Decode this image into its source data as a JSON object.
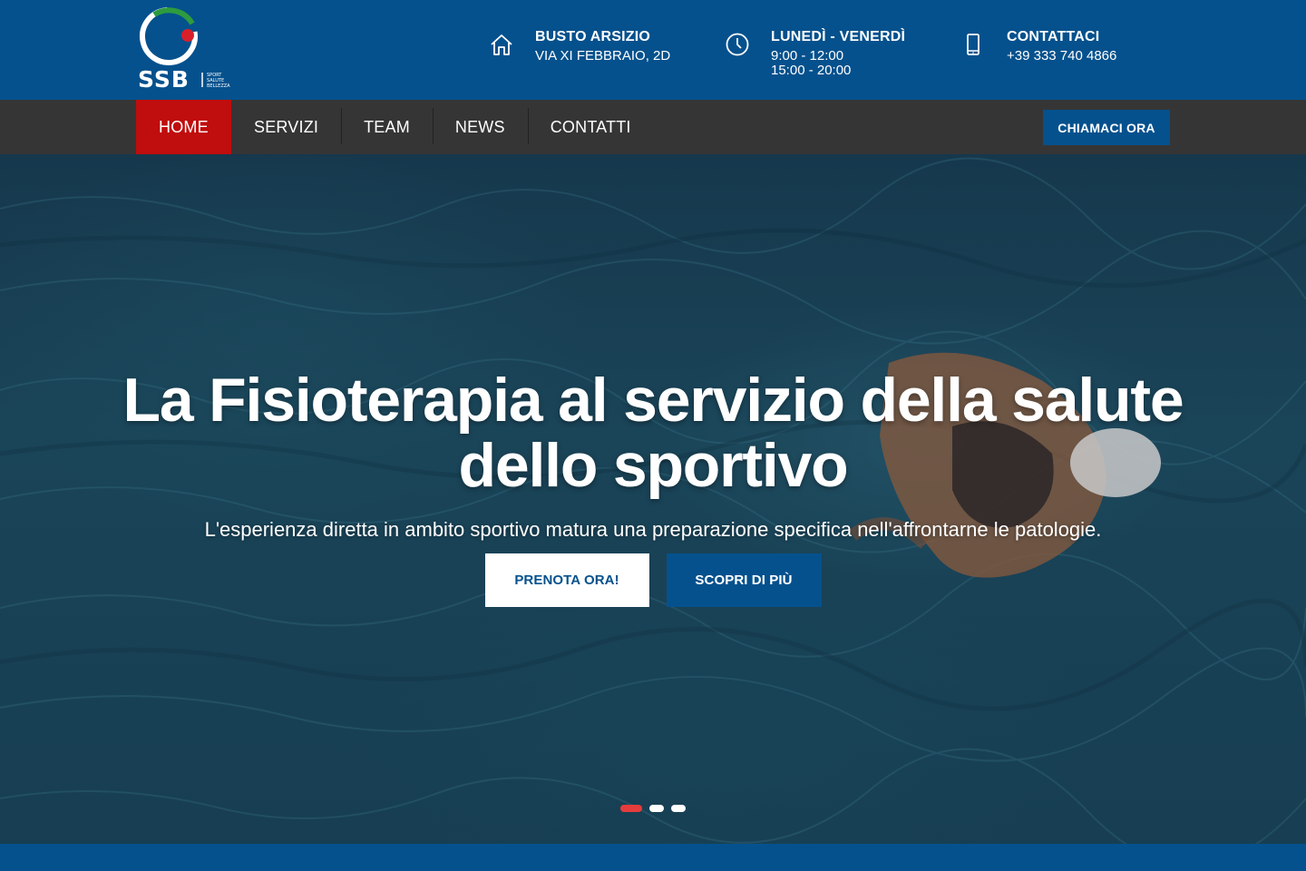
{
  "brand": {
    "logo_text": "SSB",
    "logo_tagline": [
      "SPORT",
      "SALUTE",
      "BELLEZZA"
    ],
    "logo_icon": "ssb-logo-icon"
  },
  "header": {
    "address": {
      "icon": "home-icon",
      "title": "BUSTO ARSIZIO",
      "line1": "VIA XI FEBBRAIO, 2D"
    },
    "hours": {
      "icon": "clock-icon",
      "title": "LUNEDÌ - VENERDÌ",
      "line1": "9:00 - 12:00",
      "line2": "15:00 - 20:00"
    },
    "contact": {
      "icon": "mobile-phone-icon",
      "title": "CONTATTACI",
      "line1": "+39 333 740 4866"
    }
  },
  "nav": {
    "items": [
      {
        "label": "HOME",
        "active": true
      },
      {
        "label": "SERVIZI",
        "active": false
      },
      {
        "label": "TEAM",
        "active": false
      },
      {
        "label": "NEWS",
        "active": false
      },
      {
        "label": "CONTATTI",
        "active": false
      }
    ],
    "cta_label": "CHIAMACI ORA"
  },
  "hero": {
    "title_line1": "La Fisioterapia al servizio della salute",
    "title_line2": "dello sportivo",
    "subtitle": "L'esperienza diretta in ambito sportivo matura una preparazione specifica nell'affrontarne le patologie.",
    "primary_button": "PRENOTA ORA!",
    "secondary_button": "SCOPRI DI PIÙ",
    "slides": {
      "count": 3,
      "active_index": 0
    }
  },
  "colors": {
    "brand_blue": "#05518d",
    "nav_dark": "#353535",
    "active_red": "#c00d0d",
    "dot_active": "#e53c3c"
  }
}
